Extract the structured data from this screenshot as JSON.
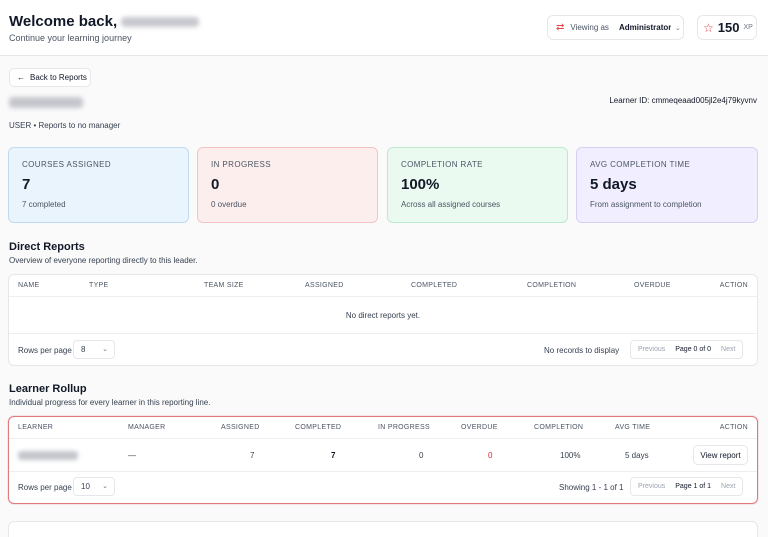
{
  "header": {
    "welcome": "Welcome back,",
    "subtitle": "Continue your learning journey",
    "viewing_label": "Viewing as",
    "viewing_role": "Administrator",
    "xp_value": "150",
    "xp_unit": "XP"
  },
  "back_button": "Back to Reports",
  "learner": {
    "id": "Learner ID: cmmeqeaad005jl2e4j79kyvnv",
    "role_line": "USER • Reports to no manager"
  },
  "stats": [
    {
      "label": "Courses Assigned",
      "value": "7",
      "sub": "7 completed"
    },
    {
      "label": "In Progress",
      "value": "0",
      "sub": "0 overdue"
    },
    {
      "label": "Completion Rate",
      "value": "100%",
      "sub": "Across all assigned courses"
    },
    {
      "label": "Avg Completion Time",
      "value": "5 days",
      "sub": "From assignment to completion"
    }
  ],
  "direct_reports": {
    "title": "Direct Reports",
    "description": "Overview of everyone reporting directly to this leader.",
    "columns": [
      "Name",
      "Type",
      "Team Size",
      "Assigned",
      "Completed",
      "Completion",
      "Overdue",
      "Action"
    ],
    "empty_text": "No direct reports yet.",
    "rows_per_page_label": "Rows per page",
    "rows_per_page": "8",
    "records_info": "No records to display",
    "prev": "Previous",
    "page_info": "Page 0 of 0",
    "next": "Next"
  },
  "rollup": {
    "title": "Learner Rollup",
    "description": "Individual progress for every learner in this reporting line.",
    "columns": [
      "Learner",
      "Manager",
      "Assigned",
      "Completed",
      "In Progress",
      "Overdue",
      "Completion",
      "Avg Time",
      "Action"
    ],
    "row": {
      "manager": "—",
      "assigned": "7",
      "completed": "7",
      "in_progress": "0",
      "overdue": "0",
      "completion": "100%",
      "avg_time": "5 days",
      "action": "View report"
    },
    "rows_per_page_label": "Rows per page",
    "rows_per_page": "10",
    "records_info": "Showing 1 - 1 of 1",
    "prev": "Previous",
    "page_info": "Page 1 of 1",
    "next": "Next"
  },
  "icons": {
    "swap": "swap-arrows-icon",
    "star": "star-icon",
    "back": "arrow-left-icon",
    "chevron": "chevron-down-icon"
  },
  "colors": {
    "accent_red": "#e0464a",
    "overdue_red": "#dc2626",
    "card_blue": "#eaf4fd",
    "card_red": "#fdeeee",
    "card_green": "#eafaf0",
    "card_purple": "#f1efff"
  }
}
